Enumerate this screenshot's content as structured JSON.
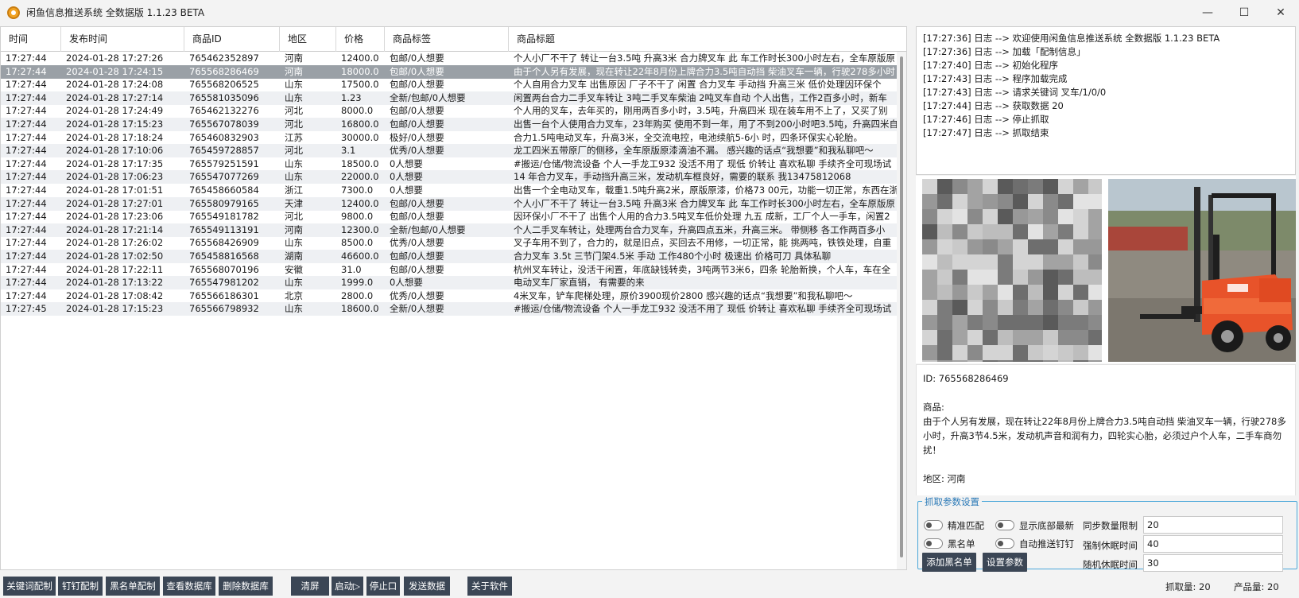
{
  "window": {
    "title": "闲鱼信息推送系统 全数据版 1.1.23 BETA",
    "controls": {
      "minimize": "—",
      "maximize": "☐",
      "close": "✕"
    }
  },
  "table": {
    "columns": [
      "时间",
      "发布时间",
      "商品ID",
      "地区",
      "价格",
      "商品标签",
      "商品标题"
    ],
    "rows": [
      [
        "17:27:44",
        "2024-01-28 17:27:26",
        "765462352897",
        "河南",
        "12400.0",
        "包邮/0人想要",
        "个人小厂不干了 转让一台3.5吨 升高3米 合力牌叉车 此 车工作时长300小时左右，全车原版原"
      ],
      [
        "17:27:44",
        "2024-01-28 17:24:15",
        "765568286469",
        "河南",
        "18000.0",
        "包邮/0人想要",
        "由于个人另有发展，现在转让22年8月份上牌合力3.5吨自动挡 柴油叉车一辆，行驶278多小时"
      ],
      [
        "17:27:44",
        "2024-01-28 17:24:08",
        "765568206525",
        "山东",
        "17500.0",
        "包邮/0人想要",
        "个人自用合力叉车 出售原因 厂子不干了 闲置 合力叉车 手动挡 升高三米  低价处理因环保个"
      ],
      [
        "17:27:44",
        "2024-01-28 17:27:14",
        "765581035096",
        "山东",
        "1.23",
        "全新/包邮/0人想要",
        "闲置两台合力二手叉车转让 3吨二手叉车柴油 2吨叉车自动 个人出售，工作2百多小时，新车"
      ],
      [
        "17:27:44",
        "2024-01-28 17:24:49",
        "765462132276",
        "河北",
        "8000.0",
        "包邮/0人想要",
        "个人用的叉车，去年买的，刚用两百多小时，3.5吨，升高四米 现在装车用不上了，又买了别"
      ],
      [
        "17:27:44",
        "2024-01-28 17:15:23",
        "765567078039",
        "河北",
        "16800.0",
        "包邮/0人想要",
        "出售一台个人使用合力叉车，23年购买 使用不到一年，用了不到200小时吧3.5吨，升高四米自"
      ],
      [
        "17:27:44",
        "2024-01-28 17:18:24",
        "765460832903",
        "江苏",
        "30000.0",
        "极好/0人想要",
        "合力1.5吨电动叉车，升高3米，全交流电控，电池续航5-6小 时，四条环保实心轮胎。"
      ],
      [
        "17:27:44",
        "2024-01-28 17:10:06",
        "765459728857",
        "河北",
        "3.1",
        "优秀/0人想要",
        "龙工四米五带原厂的侧移，全车原版原漆滴油不漏。 感兴趣的话点“我想要”和我私聊吧～"
      ],
      [
        "17:27:44",
        "2024-01-28 17:17:35",
        "765579251591",
        "山东",
        "18500.0",
        "0人想要",
        "#搬运/仓储/物流设备 个人一手龙工932 没活不用了 现低 价转让 喜欢私聊  手续齐全可现场试"
      ],
      [
        "17:27:44",
        "2024-01-28 17:06:23",
        "765547077269",
        "山东",
        "22000.0",
        "0人想要",
        "14 年合力叉车，手动挡升高三米，发动机车框良好，需要的联系 我13475812068"
      ],
      [
        "17:27:44",
        "2024-01-28 17:01:51",
        "765458660584",
        "浙江",
        "7300.0",
        "0人想要",
        "出售一个全电动叉车，载重1.5吨升高2米，原版原漆，价格73 00元，功能一切正常，东西在浙"
      ],
      [
        "17:27:44",
        "2024-01-28 17:27:01",
        "765580979165",
        "天津",
        "12400.0",
        "包邮/0人想要",
        "个人小厂不干了 转让一台3.5吨 升高3米 合力牌叉车 此 车工作时长300小时左右，全车原版原"
      ],
      [
        "17:27:44",
        "2024-01-28 17:23:06",
        "765549181782",
        "河北",
        "9800.0",
        "包邮/0人想要",
        "因环保小厂不干了 出售个人用的合力3.5吨叉车低价处理 九五 成新，工厂个人一手车，闲置2"
      ],
      [
        "17:27:44",
        "2024-01-28 17:21:14",
        "765549113191",
        "河南",
        "12300.0",
        "全新/包邮/0人想要",
        "个人二手叉车转让，处理两台合力叉车，升高四点五米，升高三米。 带侧移  各工作两百多小"
      ],
      [
        "17:27:44",
        "2024-01-28 17:26:02",
        "765568426909",
        "山东",
        "8500.0",
        "优秀/0人想要",
        "叉子车用不到了，合力的，就是旧点，买回去不用修，一切正常，能 挑两吨，铁铁处理，自重"
      ],
      [
        "17:27:44",
        "2024-01-28 17:02:50",
        "765458816568",
        "湖南",
        "46600.0",
        "包邮/0人想要",
        "合力叉车 3.5t 三节门架4.5米 手动 工作480个小时 极速出 价格可刀 具体私聊"
      ],
      [
        "17:27:44",
        "2024-01-28 17:22:11",
        "765568070196",
        "安徽",
        "31.0",
        "包邮/0人想要",
        "杭州叉车转让，没活干闲置，年底缺钱转卖，3吨两节3米6，四条 轮胎新换，个人车，车在全"
      ],
      [
        "17:27:44",
        "2024-01-28 17:13:22",
        "765547981202",
        "山东",
        "1999.0",
        "0人想要",
        "电动叉车厂家直销，  有需要的来"
      ],
      [
        "17:27:44",
        "2024-01-28 17:08:42",
        "765566186301",
        "北京",
        "2800.0",
        "优秀/0人想要",
        "4米叉车，铲车爬梯处理，原价3900现价2800 感兴趣的话点“我想要”和我私聊吧～"
      ],
      [
        "17:27:45",
        "2024-01-28 17:15:23",
        "765566798932",
        "山东",
        "18600.0",
        "全新/0人想要",
        "#搬运/仓储/物流设备 个人一手龙工932 没活不用了 现低 价转让 喜欢私聊  手续齐全可现场试"
      ]
    ],
    "selected_row": 1
  },
  "log": [
    "[17:27:36] 日志 --> 欢迎使用闲鱼信息推送系统 全数据版 1.1.23 BETA",
    "[17:27:36] 日志 --> 加载「配制信息」",
    "[17:27:40] 日志 --> 初始化程序",
    "[17:27:43] 日志 --> 程序加载完成",
    "[17:27:43] 日志 --> 请求关键词 叉车/1/0/0",
    "[17:27:44] 日志 --> 获取数据 20",
    "[17:27:46] 日志 --> 停止抓取",
    "[17:27:47] 日志 --> 抓取结束"
  ],
  "detail": {
    "id_line": "ID: 765568286469",
    "goods_label": "商品:",
    "goods_text": "由于个人另有发展，现在转让22年8月份上牌合力3.5吨自动挡 柴油叉车一辆，行驶278多小时，升高3节4.5米，发动机声音和润有力，四轮实心胎，必须过户个人车，二手车商勿扰！",
    "region_line": "地区: 河南"
  },
  "params": {
    "group_title": "抓取参数设置",
    "exact_match": "精准匹配",
    "show_bottom_latest": "显示底部最新",
    "blacklist": "黑名单",
    "auto_push_dingtalk": "自动推送钉钉",
    "sync_limit_label": "同步数量限制",
    "sync_limit_value": "20",
    "force_sleep_label": "强制休眠时间",
    "force_sleep_value": "40",
    "random_sleep_label": "随机休眠时间",
    "random_sleep_value": "30",
    "add_blacklist_button": "添加黑名单",
    "set_params_button": "设置参数"
  },
  "toolbar": {
    "keyword_config": "关键词配制",
    "dingtalk_config": "钉钉配制",
    "blacklist_config": "黑名单配制",
    "view_db": "查看数据库",
    "delete_db": "删除数据库",
    "clear_screen": "清屏",
    "start": "启动▷",
    "stop": "停止口",
    "send_data": "发送数据",
    "about": "关于软件"
  },
  "status": {
    "fetch_count": "抓取量: 20",
    "product_count": "产品量: 20"
  },
  "colors": {
    "accent_dark": "#3b4655",
    "selected_row": "#9aa0a6",
    "group_border": "#4aa7d9",
    "forklift_orange": "#e8532a"
  }
}
